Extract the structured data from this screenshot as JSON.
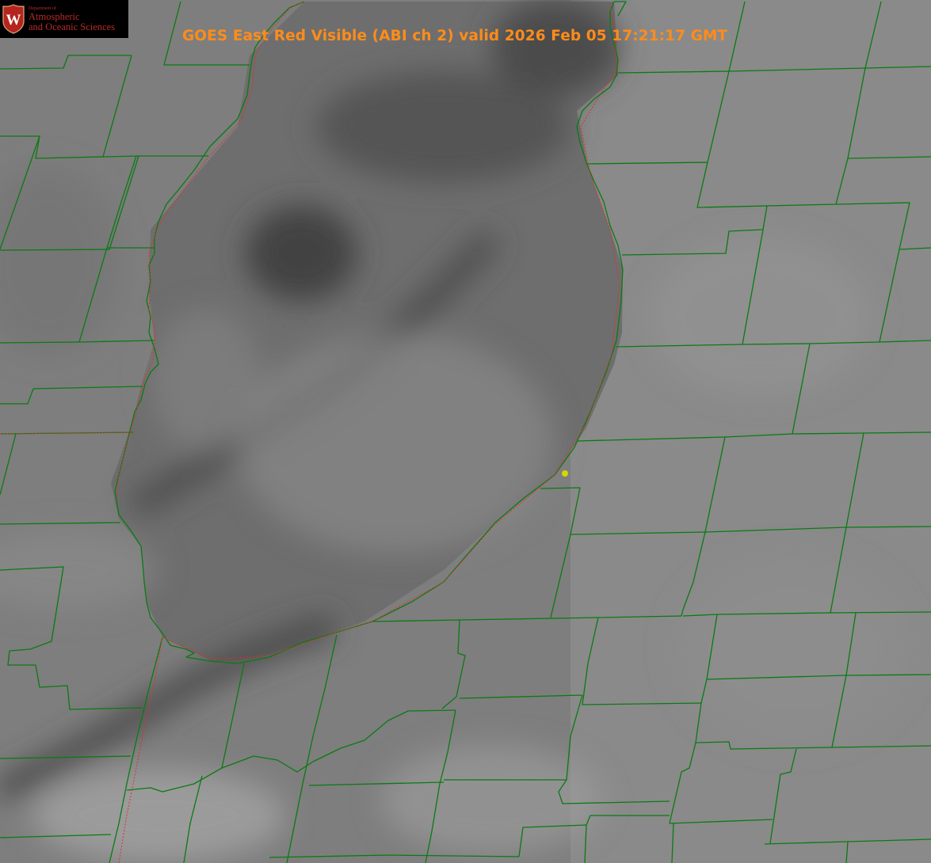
{
  "title": "GOES East Red Visible (ABI ch 2) valid 2026 Feb 05 17:21:17 GMT",
  "logo": {
    "dept_line": "Department of",
    "line1": "Atmospheric",
    "line2": "and Oceanic Sciences",
    "seal_letter": "W",
    "seal_color": "#b5241e",
    "text_color": "#ba2a28"
  },
  "map": {
    "boundary_color": "#0b7a12",
    "state_border_color": "#e0302a",
    "marker_color": "#d6d600"
  }
}
